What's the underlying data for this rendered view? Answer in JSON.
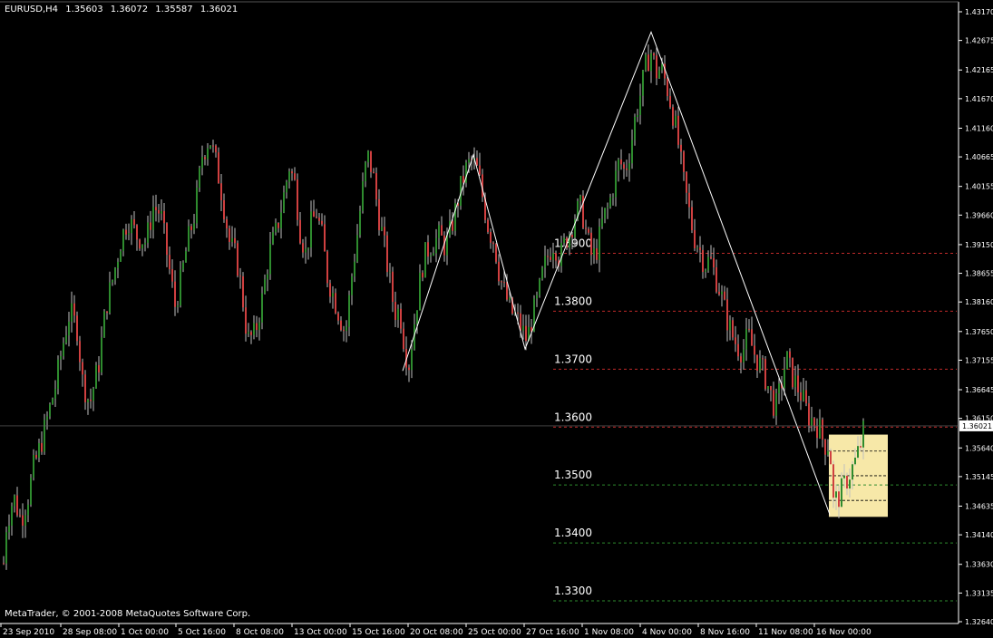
{
  "header": {
    "symbol": "EURUSD,H4",
    "open": "1.35603",
    "high": "1.36072",
    "low": "1.35587",
    "close": "1.36021"
  },
  "footer": {
    "copyright": "MetaTrader, © 2001-2008 MetaQuotes Software Corp."
  },
  "colors": {
    "background": "#000000",
    "axis": "#ffffff",
    "bull_candle": "#2e8b2e",
    "bear_candle": "#d04040",
    "candle_wick": "#bfbfbf",
    "resistance_line": "#c02a2a",
    "support_line": "#2e8b2e",
    "zigzag": "#ffffff",
    "highlight_box": "#f7e8a8",
    "level_text": "#ffffff"
  },
  "chart_data": {
    "type": "candlestick",
    "title": "EURUSD,H4",
    "ylim": [
      1.3264,
      1.4317
    ],
    "y_axis_ticks": [
      "1.43170",
      "1.42675",
      "1.42165",
      "1.41670",
      "1.41160",
      "1.40665",
      "1.40155",
      "1.39660",
      "1.39150",
      "1.38655",
      "1.38160",
      "1.37650",
      "1.37155",
      "1.36645",
      "1.36150",
      "1.35640",
      "1.35145",
      "1.34635",
      "1.34140",
      "1.33630",
      "1.33135",
      "1.32640"
    ],
    "current_price": "1.36021",
    "x_axis_labels": [
      "23 Sep 2010",
      "28 Sep 08:00",
      "1 Oct 00:00",
      "5 Oct 16:00",
      "8 Oct 08:00",
      "13 Oct 00:00",
      "15 Oct 16:00",
      "20 Oct 08:00",
      "25 Oct 00:00",
      "27 Oct 16:00",
      "1 Nov 08:00",
      "4 Nov 00:00",
      "8 Nov 16:00",
      "11 Nov 08:00",
      "16 Nov 00:00"
    ],
    "price_path": [
      [
        0,
        1.33
      ],
      [
        6,
        1.343
      ],
      [
        14,
        1.348
      ],
      [
        22,
        1.344
      ],
      [
        30,
        1.348
      ],
      [
        36,
        1.353
      ],
      [
        44,
        1.357
      ],
      [
        52,
        1.362
      ],
      [
        60,
        1.367
      ],
      [
        68,
        1.374
      ],
      [
        76,
        1.38
      ],
      [
        84,
        1.377
      ],
      [
        90,
        1.368
      ],
      [
        98,
        1.364
      ],
      [
        108,
        1.371
      ],
      [
        116,
        1.381
      ],
      [
        124,
        1.386
      ],
      [
        132,
        1.392
      ],
      [
        140,
        1.396
      ],
      [
        150,
        1.393
      ],
      [
        160,
        1.392
      ],
      [
        168,
        1.398
      ],
      [
        176,
        1.397
      ],
      [
        184,
        1.389
      ],
      [
        192,
        1.381
      ],
      [
        198,
        1.385
      ],
      [
        206,
        1.392
      ],
      [
        214,
        1.397
      ],
      [
        222,
        1.407
      ],
      [
        230,
        1.41
      ],
      [
        238,
        1.405
      ],
      [
        244,
        1.4
      ],
      [
        252,
        1.392
      ],
      [
        260,
        1.389
      ],
      [
        266,
        1.383
      ],
      [
        272,
        1.375
      ],
      [
        280,
        1.376
      ],
      [
        288,
        1.382
      ],
      [
        296,
        1.39
      ],
      [
        304,
        1.394
      ],
      [
        312,
        1.4
      ],
      [
        318,
        1.405
      ],
      [
        324,
        1.402
      ],
      [
        330,
        1.394
      ],
      [
        336,
        1.39
      ],
      [
        342,
        1.395
      ],
      [
        348,
        1.397
      ],
      [
        354,
        1.393
      ],
      [
        360,
        1.386
      ],
      [
        366,
        1.383
      ],
      [
        372,
        1.38
      ],
      [
        380,
        1.376
      ],
      [
        386,
        1.385
      ],
      [
        392,
        1.392
      ],
      [
        398,
        1.4
      ],
      [
        404,
        1.407
      ],
      [
        410,
        1.404
      ],
      [
        416,
        1.397
      ],
      [
        422,
        1.392
      ],
      [
        428,
        1.386
      ],
      [
        434,
        1.38
      ],
      [
        440,
        1.38
      ],
      [
        446,
        1.373
      ],
      [
        450,
        1.371
      ],
      [
        455,
        1.377
      ],
      [
        460,
        1.383
      ],
      [
        466,
        1.389
      ],
      [
        472,
        1.391
      ],
      [
        478,
        1.392
      ],
      [
        484,
        1.393
      ],
      [
        490,
        1.391
      ],
      [
        496,
        1.394
      ],
      [
        502,
        1.398
      ],
      [
        508,
        1.402
      ],
      [
        514,
        1.405
      ],
      [
        520,
        1.406
      ],
      [
        526,
        1.404
      ],
      [
        532,
        1.399
      ],
      [
        538,
        1.394
      ],
      [
        544,
        1.392
      ],
      [
        550,
        1.386
      ],
      [
        556,
        1.383
      ],
      [
        562,
        1.38
      ],
      [
        568,
        1.379
      ],
      [
        574,
        1.377
      ],
      [
        580,
        1.375
      ],
      [
        586,
        1.379
      ],
      [
        592,
        1.382
      ],
      [
        598,
        1.387
      ],
      [
        604,
        1.39
      ],
      [
        610,
        1.392
      ],
      [
        616,
        1.389
      ],
      [
        622,
        1.392
      ],
      [
        628,
        1.394
      ],
      [
        634,
        1.397
      ],
      [
        640,
        1.398
      ],
      [
        646,
        1.393
      ],
      [
        652,
        1.389
      ],
      [
        658,
        1.391
      ],
      [
        664,
        1.396
      ],
      [
        670,
        1.398
      ],
      [
        676,
        1.402
      ],
      [
        682,
        1.406
      ],
      [
        688,
        1.404
      ],
      [
        694,
        1.408
      ],
      [
        700,
        1.414
      ],
      [
        706,
        1.418
      ],
      [
        712,
        1.423
      ],
      [
        718,
        1.425
      ],
      [
        722,
        1.421
      ],
      [
        728,
        1.422
      ],
      [
        734,
        1.419
      ],
      [
        740,
        1.415
      ],
      [
        746,
        1.41
      ],
      [
        752,
        1.403
      ],
      [
        758,
        1.398
      ],
      [
        764,
        1.393
      ],
      [
        770,
        1.391
      ],
      [
        776,
        1.388
      ],
      [
        782,
        1.389
      ],
      [
        788,
        1.386
      ],
      [
        794,
        1.383
      ],
      [
        800,
        1.379
      ],
      [
        806,
        1.376
      ],
      [
        812,
        1.374
      ],
      [
        818,
        1.373
      ],
      [
        824,
        1.376
      ],
      [
        830,
        1.373
      ],
      [
        836,
        1.371
      ],
      [
        842,
        1.369
      ],
      [
        848,
        1.366
      ],
      [
        854,
        1.363
      ],
      [
        860,
        1.367
      ],
      [
        866,
        1.372
      ],
      [
        872,
        1.369
      ],
      [
        878,
        1.367
      ],
      [
        884,
        1.365
      ],
      [
        890,
        1.362
      ],
      [
        896,
        1.361
      ],
      [
        902,
        1.36
      ],
      [
        908,
        1.357
      ],
      [
        914,
        1.357
      ],
      [
        918,
        1.347
      ],
      [
        924,
        1.348
      ],
      [
        930,
        1.35
      ],
      [
        936,
        1.352
      ],
      [
        942,
        1.354
      ],
      [
        948,
        1.357
      ],
      [
        952,
        1.36
      ]
    ],
    "zigzag": [
      [
        1.3697,
        "20 Oct"
      ],
      [
        1.407,
        "25 Oct"
      ],
      [
        1.3735,
        "27 Oct"
      ],
      [
        1.4282,
        "4 Nov"
      ],
      [
        1.3449,
        "16 Nov"
      ]
    ],
    "horizontal_levels": [
      {
        "label": "1.3900",
        "value": 1.39,
        "kind": "resistance"
      },
      {
        "label": "1.3800",
        "value": 1.38,
        "kind": "resistance"
      },
      {
        "label": "1.3700",
        "value": 1.37,
        "kind": "resistance"
      },
      {
        "label": "1.3600",
        "value": 1.36,
        "kind": "resistance"
      },
      {
        "label": "1.3500",
        "value": 1.35,
        "kind": "support"
      },
      {
        "label": "1.3400",
        "value": 1.34,
        "kind": "support"
      },
      {
        "label": "1.3300",
        "value": 1.33,
        "kind": "support"
      }
    ],
    "highlight_box": {
      "y_low": 1.3445,
      "y_high": 1.3587
    },
    "grid": false
  }
}
